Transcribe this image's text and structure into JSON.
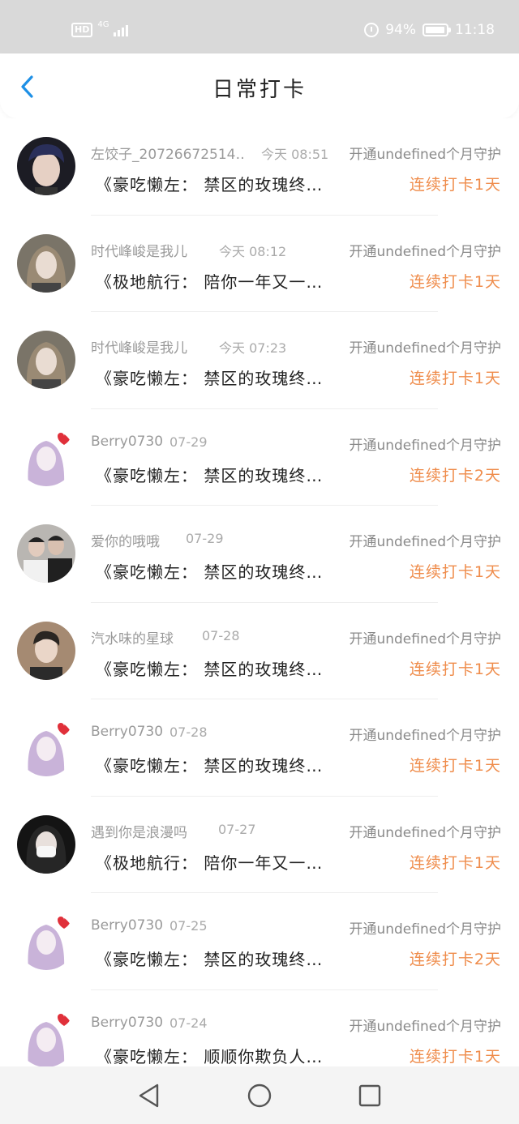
{
  "status_bar": {
    "hd_badge": "HD",
    "network": "4G",
    "battery_percent": "94%",
    "battery_level": 0.94,
    "time": "11:18"
  },
  "header": {
    "title": "日常打卡"
  },
  "entries": [
    {
      "name": "左饺子_20726672514…",
      "time": "今天 08:51",
      "vip": "开通undefined个月守护",
      "quote": "《豪吃懒左：  禁区的玫瑰终…",
      "streak": "连续打卡1天",
      "avatar": "dark-haired-boy"
    },
    {
      "name": "时代峰峻是我儿",
      "time": "今天 08:12",
      "vip": "开通undefined个月守护",
      "quote": "《极地航行：  陪你一年又一…",
      "streak": "连续打卡1天",
      "avatar": "long-hair-girl"
    },
    {
      "name": "时代峰峻是我儿",
      "time": "今天 07:23",
      "vip": "开通undefined个月守护",
      "quote": "《豪吃懒左：  禁区的玫瑰终…",
      "streak": "连续打卡1天",
      "avatar": "long-hair-girl"
    },
    {
      "name": "Berry0730",
      "time": "07-29",
      "vip": "开通undefined个月守护",
      "quote": "《豪吃懒左：  禁区的玫瑰终…",
      "streak": "连续打卡2天",
      "avatar": "anime-girl-heart"
    },
    {
      "name": "爱你的哦哦",
      "time": "07-29",
      "vip": "开通undefined个月守护",
      "quote": "《豪吃懒左：  禁区的玫瑰终…",
      "streak": "连续打卡1天",
      "avatar": "two-boys"
    },
    {
      "name": "汽水味的星球",
      "time": "07-28",
      "vip": "开通undefined个月守护",
      "quote": "《豪吃懒左：  禁区的玫瑰终…",
      "streak": "连续打卡1天",
      "avatar": "boy-portrait"
    },
    {
      "name": "Berry0730",
      "time": "07-28",
      "vip": "开通undefined个月守护",
      "quote": "《豪吃懒左：  禁区的玫瑰终…",
      "streak": "连续打卡1天",
      "avatar": "anime-girl-heart"
    },
    {
      "name": "遇到你是浪漫吗",
      "time": "07-27",
      "vip": "开通undefined个月守护",
      "quote": "《极地航行：  陪你一年又一…",
      "streak": "连续打卡1天",
      "avatar": "masked-girl"
    },
    {
      "name": "Berry0730",
      "time": "07-25",
      "vip": "开通undefined个月守护",
      "quote": "《豪吃懒左：  禁区的玫瑰终…",
      "streak": "连续打卡2天",
      "avatar": "anime-girl-heart"
    },
    {
      "name": "Berry0730",
      "time": "07-24",
      "vip": "开通undefined个月守护",
      "quote": "《豪吃懒左：  顺顺你欺负人…",
      "streak": "连续打卡1天",
      "avatar": "anime-girl-heart"
    }
  ],
  "colors": {
    "accent_blue": "#1e90e6",
    "streak_orange": "#ef8c4b",
    "status_bar_bg": "#d9d9d9"
  },
  "navigation": {
    "back_icon": "chevron-left-icon",
    "system_buttons": [
      "back-triangle-icon",
      "home-circle-icon",
      "recents-square-icon"
    ]
  }
}
